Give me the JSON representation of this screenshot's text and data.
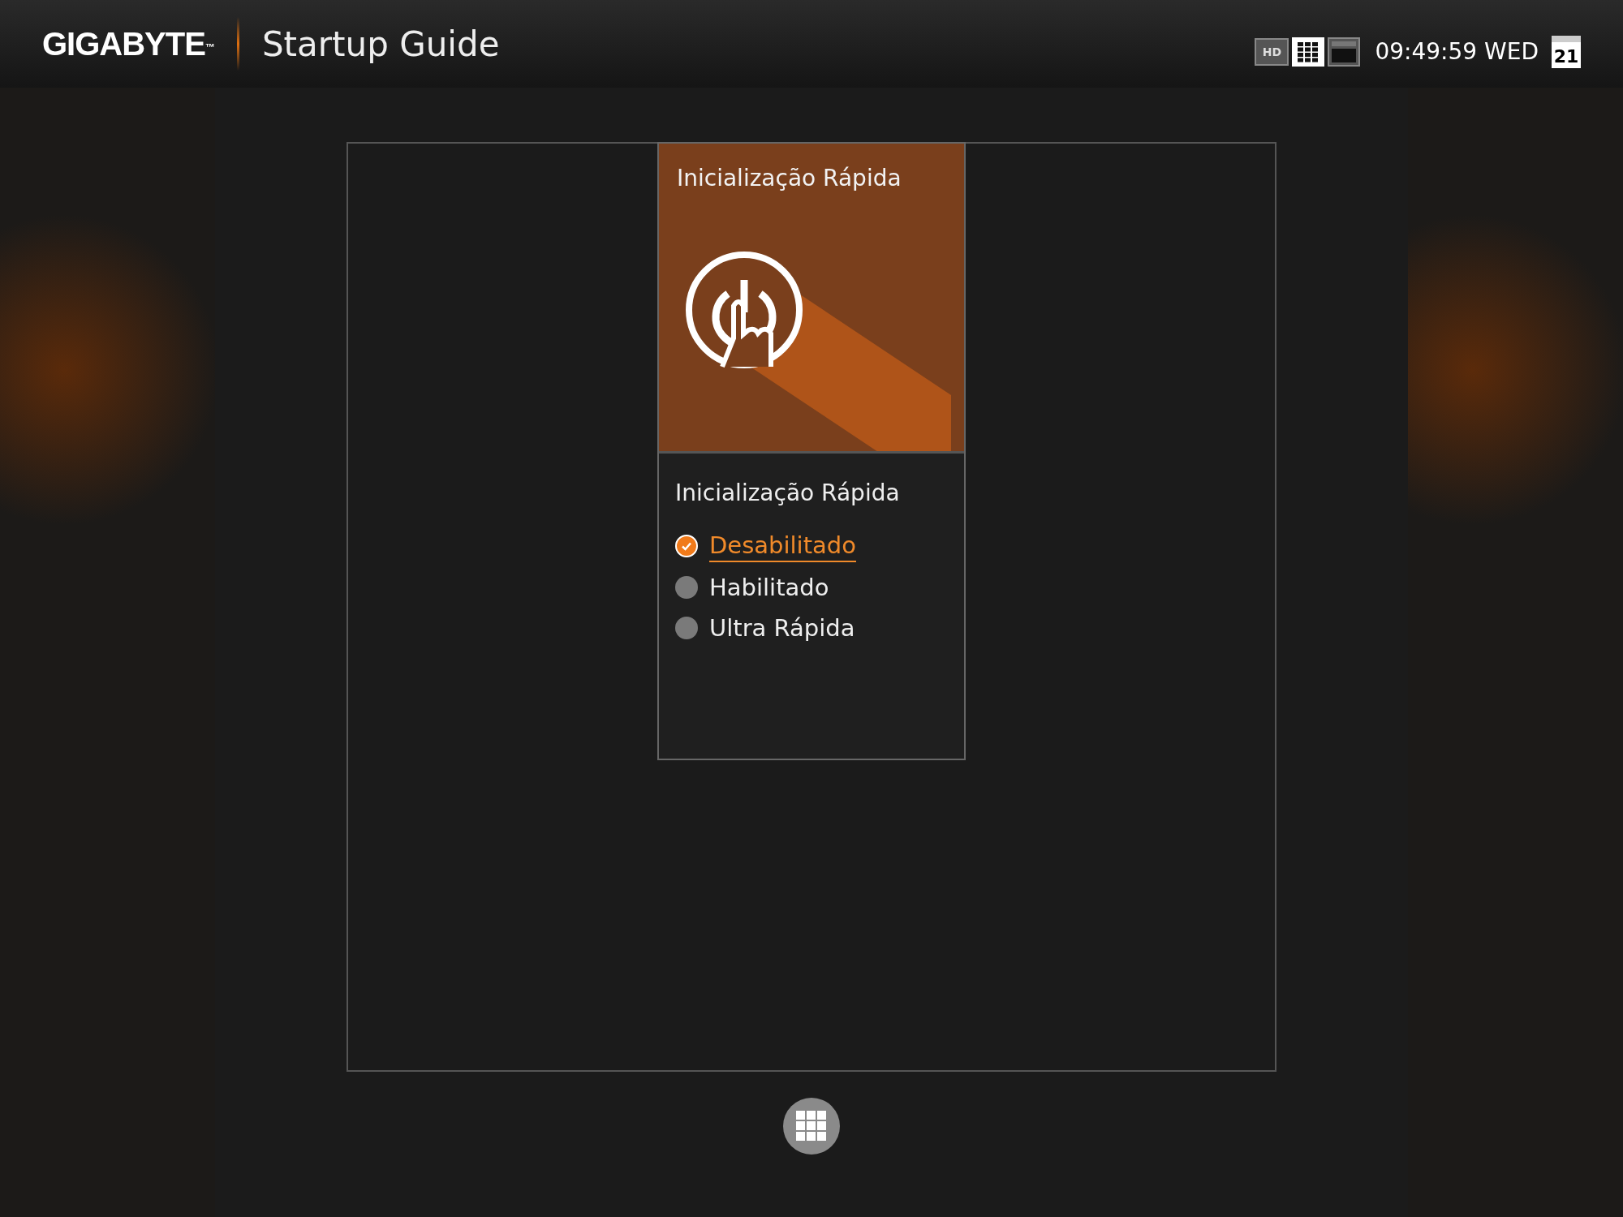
{
  "header": {
    "brand": "GIGABYTE",
    "trademark": "™",
    "title": "Startup Guide",
    "view_buttons": [
      {
        "kind": "hd",
        "label": "HD",
        "selected": false
      },
      {
        "kind": "grid",
        "selected": true
      },
      {
        "kind": "single",
        "selected": false
      }
    ],
    "clock": "09:49:59 WED",
    "calendar_day": "21"
  },
  "tile": {
    "title": "Inicialização Rápida",
    "option_heading": "Inicialização Rápida",
    "options": [
      {
        "label": "Desabilitado",
        "selected": true
      },
      {
        "label": "Habilitado",
        "selected": false
      },
      {
        "label": "Ultra Rápida",
        "selected": false
      }
    ]
  }
}
